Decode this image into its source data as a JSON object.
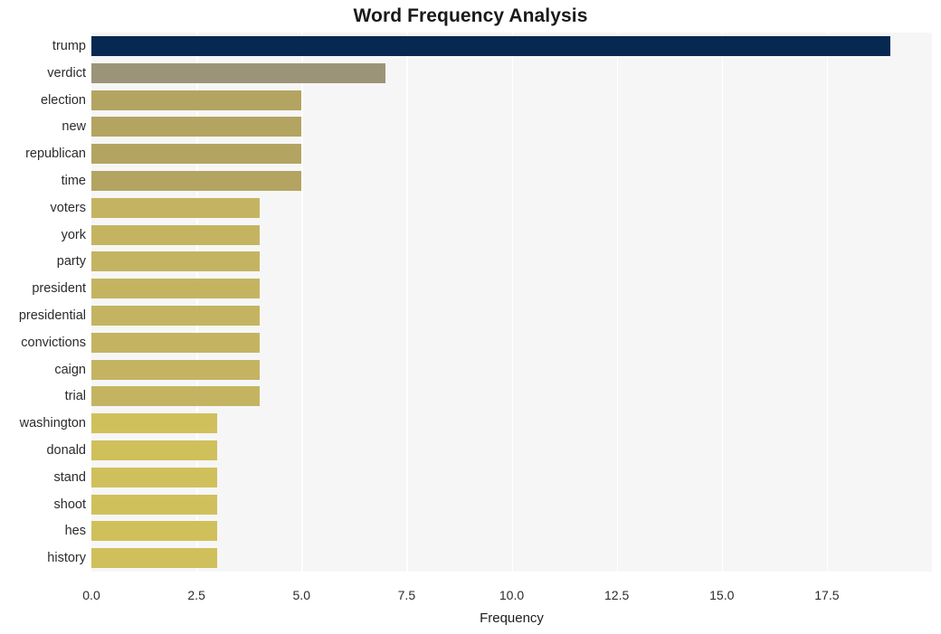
{
  "chart_data": {
    "type": "bar",
    "orientation": "horizontal",
    "title": "Word Frequency Analysis",
    "xlabel": "Frequency",
    "ylabel": "",
    "categories": [
      "trump",
      "verdict",
      "election",
      "new",
      "republican",
      "time",
      "voters",
      "york",
      "party",
      "president",
      "presidential",
      "convictions",
      "caign",
      "trial",
      "washington",
      "donald",
      "stand",
      "shoot",
      "hes",
      "history"
    ],
    "values": [
      19,
      7,
      5,
      5,
      5,
      5,
      4,
      4,
      4,
      4,
      4,
      4,
      4,
      4,
      3,
      3,
      3,
      3,
      3,
      3
    ],
    "bar_colors": [
      "#062851",
      "#9c9478",
      "#b4a461",
      "#b4a461",
      "#b4a461",
      "#b4a461",
      "#c4b462",
      "#c4b462",
      "#c4b462",
      "#c4b462",
      "#c4b462",
      "#c4b462",
      "#c4b462",
      "#c4b462",
      "#d0c05b",
      "#d0c05b",
      "#d0c05b",
      "#d0c05b",
      "#d0c05b",
      "#d0c05b"
    ],
    "xlim": [
      0,
      20.0
    ],
    "xticks": [
      "0.0",
      "2.5",
      "5.0",
      "7.5",
      "10.0",
      "12.5",
      "15.0",
      "17.5"
    ],
    "xtick_values": [
      0,
      2.5,
      5,
      7.5,
      10,
      12.5,
      15,
      17.5
    ],
    "grid": true,
    "grid_axis": "x",
    "grid_color": "#ffffff",
    "legend": false,
    "plot_background": "#f6f6f7",
    "figure_background": "#ffffff"
  }
}
